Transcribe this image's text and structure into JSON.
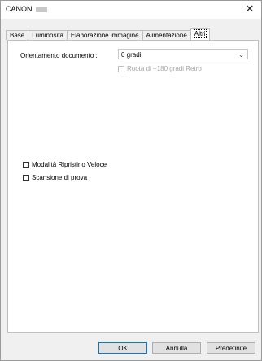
{
  "window": {
    "title": "CANON",
    "close_label": "✕"
  },
  "tabs": [
    {
      "label": "Base"
    },
    {
      "label": "Luminosità"
    },
    {
      "label": "Elaborazione immagine"
    },
    {
      "label": "Alimentazione"
    },
    {
      "label": "Altri",
      "active": true
    }
  ],
  "altri": {
    "orientation_label": "Orientamento documento :",
    "orientation_value": "0 gradi",
    "rotate_180_label": "Ruota di +180 gradi Retro",
    "rotate_180_checked": false,
    "rotate_180_disabled": true,
    "quick_restore_label": "Modalità Ripristino Veloce",
    "quick_restore_checked": false,
    "test_scan_label": "Scansione di prova",
    "test_scan_checked": false
  },
  "buttons": {
    "ok": "OK",
    "cancel": "Annulla",
    "defaults": "Predefinite"
  }
}
